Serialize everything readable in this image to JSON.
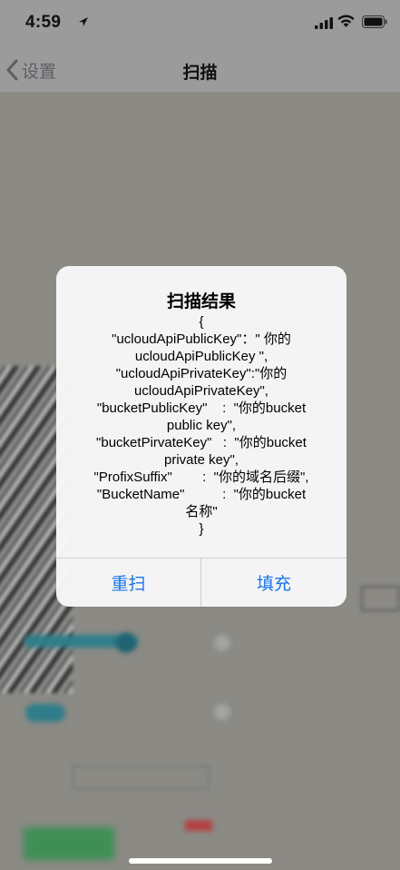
{
  "status": {
    "time": "4:59"
  },
  "nav": {
    "back_label": "设置",
    "title": "扫描"
  },
  "alert": {
    "title": "扫描结果",
    "message_lines": [
      "{",
      "\"ucloudApiPublicKey\"：\" 你的",
      "ucloudApiPublicKey \",",
      "\"ucloudApiPrivateKey\":\"你的",
      "ucloudApiPrivateKey\",",
      "\"bucketPublicKey\"    :  \"你的bucket",
      "public key\",",
      "\"bucketPirvateKey\"   :  \"你的bucket",
      "private key\",",
      "\"ProfixSuffix\"        :  \"你的域名后缀\",",
      "\"BucketName\"          :  \"你的bucket",
      "名称\"",
      "}"
    ],
    "rescan_label": "重扫",
    "fill_label": "填充"
  },
  "colors": {
    "accent": "#1a73e8"
  }
}
